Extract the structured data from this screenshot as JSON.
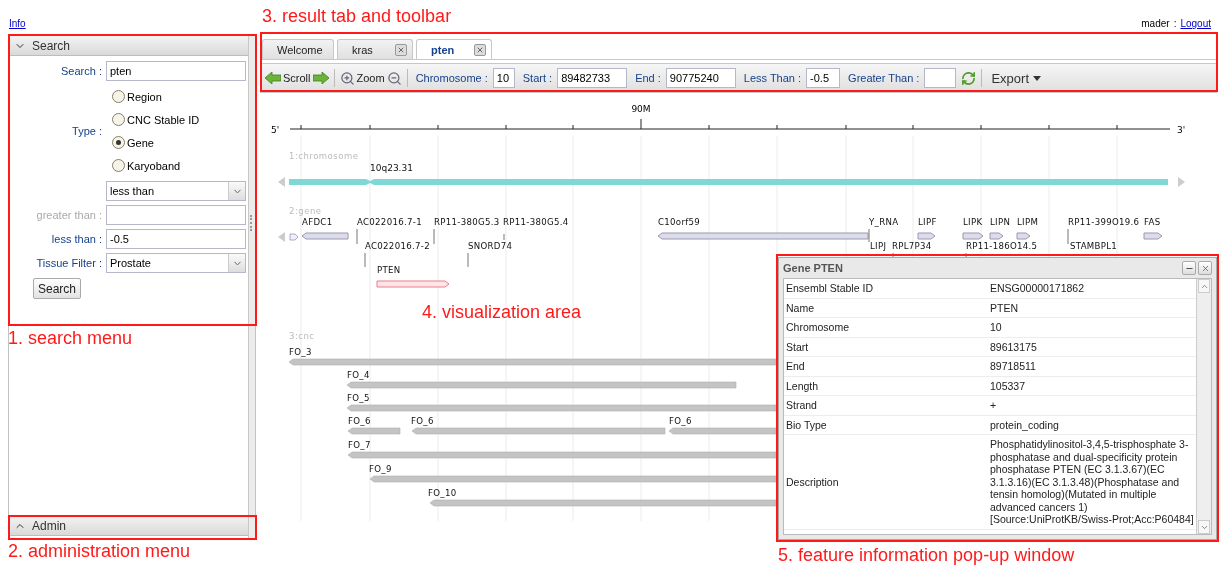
{
  "header": {
    "info_link": "Info",
    "user": "mader",
    "separator": ":",
    "logout_link": "Logout"
  },
  "search_panel": {
    "title": "Search",
    "expanded": true,
    "rows": [
      {
        "kind": "text",
        "label": "Search :",
        "value": "pten",
        "disabled": false
      },
      {
        "kind": "radio",
        "label": "Type :",
        "options": [
          {
            "label": "Region",
            "selected": false
          },
          {
            "label": "CNC Stable ID",
            "selected": false
          },
          {
            "label": "Gene",
            "selected": true
          },
          {
            "label": "Karyoband",
            "selected": false
          }
        ]
      },
      {
        "kind": "select",
        "value": "less than"
      },
      {
        "kind": "text",
        "label": "greater than :",
        "disabled": true
      },
      {
        "kind": "text",
        "label": "less than :",
        "value": "-0.5",
        "disabled": false
      },
      {
        "kind": "select",
        "label": "Tissue Filter :",
        "value": "Prostate"
      }
    ],
    "button": "Search"
  },
  "admin_panel": {
    "title": "Admin",
    "expanded": false
  },
  "tabs": [
    {
      "label": "Welcome",
      "closable": false,
      "selected": false
    },
    {
      "label": "kras",
      "closable": true,
      "selected": false
    },
    {
      "label": "pten",
      "closable": true,
      "selected": true
    }
  ],
  "toolbar": {
    "scroll": "Scroll",
    "zoom": "Zoom",
    "fields": [
      {
        "label": "Chromosome :",
        "value": "10"
      },
      {
        "label": "Start :",
        "value": "89482733"
      },
      {
        "label": "End :",
        "value": "90775240"
      },
      {
        "label": "Less Than :",
        "value": "-0.5"
      },
      {
        "label": "Greater Than :"
      }
    ],
    "export": "Export"
  },
  "ruler": {
    "major_tick": "90M",
    "left_end": "5'",
    "right_end": "3'"
  },
  "tracks": [
    {
      "label": "1:chromosome",
      "kind": "chromosome",
      "features": [
        {
          "name": "10q23.31",
          "selected": false
        }
      ]
    },
    {
      "label": "2:gene",
      "kind": "gene",
      "features": [
        {
          "name": "AFDC1",
          "selected": false
        },
        {
          "name": "AC022016.7-1",
          "selected": false
        },
        {
          "name": "RP11-380G5.3",
          "selected": false
        },
        {
          "name": "RP11-380G5.4",
          "selected": false
        },
        {
          "name": "C10orf59",
          "selected": false
        },
        {
          "name": "Y_RNA",
          "selected": false
        },
        {
          "name": "LIPF",
          "selected": false
        },
        {
          "name": "LIPK",
          "selected": false
        },
        {
          "name": "LIPN",
          "selected": false
        },
        {
          "name": "LIPM",
          "selected": false
        },
        {
          "name": "RP11-399O19.6",
          "selected": false
        },
        {
          "name": "FAS",
          "selected": false
        },
        {
          "name": "AC022016.7-2",
          "selected": false
        },
        {
          "name": "SNORD74",
          "selected": false
        },
        {
          "name": "LIPJ",
          "selected": false
        },
        {
          "name": "RPL7P34",
          "selected": false
        },
        {
          "name": "RP11-186O14.5",
          "selected": false
        },
        {
          "name": "STAMBPL1",
          "selected": false
        },
        {
          "name": "PTEN",
          "selected": true
        }
      ]
    },
    {
      "label": "3:cnc",
      "kind": "cnc",
      "features": [
        {
          "name": "FO_3",
          "selected": false
        },
        {
          "name": "FO_4",
          "selected": false
        },
        {
          "name": "FO_5",
          "selected": false
        },
        {
          "name": "FO_6",
          "selected": false
        },
        {
          "name": "FO_6",
          "selected": false
        },
        {
          "name": "FO_6",
          "selected": false
        },
        {
          "name": "FO_7",
          "selected": false
        },
        {
          "name": "FO_9",
          "selected": false
        },
        {
          "name": "FO_10",
          "selected": false
        }
      ]
    }
  ],
  "popup": {
    "title": "Gene PTEN",
    "rows": [
      {
        "label": "Ensembl Stable ID",
        "value": "ENSG00000171862"
      },
      {
        "label": "Name",
        "value": "PTEN"
      },
      {
        "label": "Chromosome",
        "value": "10"
      },
      {
        "label": "Start",
        "value": "89613175"
      },
      {
        "label": "End",
        "value": "89718511"
      },
      {
        "label": "Length",
        "value": "105337"
      },
      {
        "label": "Strand",
        "value": "+"
      },
      {
        "label": "Bio Type",
        "value": "protein_coding"
      },
      {
        "label": "Description",
        "value": "Phosphatidylinositol-3,4,5-trisphosphate 3-phosphatase and dual-specificity protein phosphatase PTEN (EC 3.1.3.67)(EC 3.1.3.16)(EC 3.1.3.48)(Phosphatase and tensin homolog)(Mutated in multiple advanced cancers 1) [Source:UniProtKB/Swiss-Prot;Acc:P60484]"
      }
    ]
  },
  "annotations": [
    {
      "label": "1. search menu"
    },
    {
      "label": "2. administration menu"
    },
    {
      "label": "3. result tab and toolbar"
    },
    {
      "label": "4. visualization area"
    },
    {
      "label": "5. feature information pop-up window"
    }
  ]
}
